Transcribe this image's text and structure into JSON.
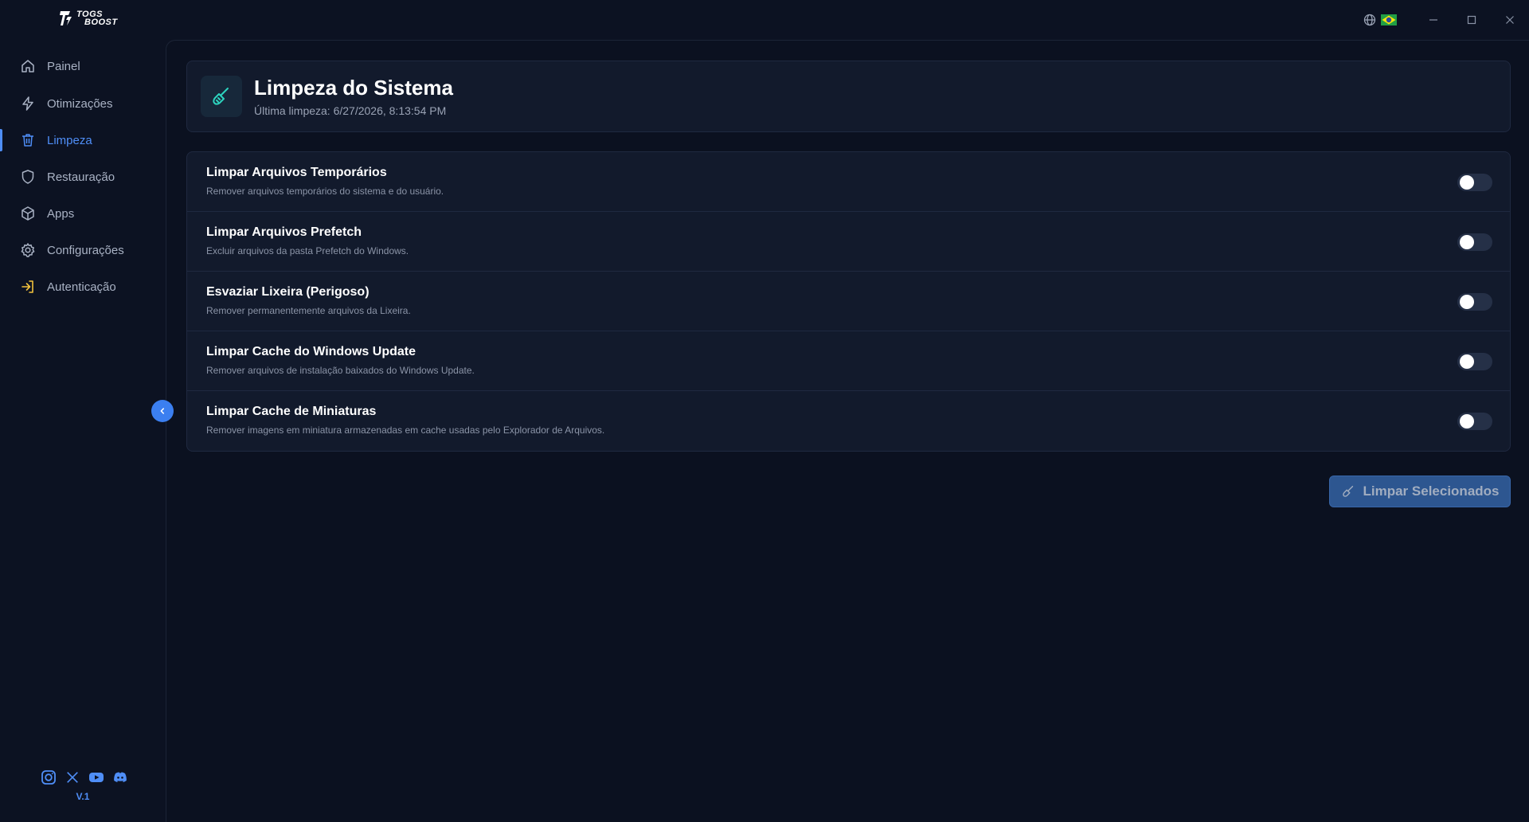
{
  "app": {
    "logo_line1": "TOGS",
    "logo_line2": "BOOST",
    "version": "V.1",
    "accent": "#4f8ef7"
  },
  "titlebar": {
    "language_icon": "globe-icon",
    "flag": "brazil-flag"
  },
  "sidebar": {
    "items": [
      {
        "label": "Painel",
        "icon": "home-icon"
      },
      {
        "label": "Otimizações",
        "icon": "lightning-icon"
      },
      {
        "label": "Limpeza",
        "icon": "trash-icon",
        "active": true
      },
      {
        "label": "Restauração",
        "icon": "shield-icon"
      },
      {
        "label": "Apps",
        "icon": "package-icon"
      },
      {
        "label": "Configurações",
        "icon": "gear-icon"
      },
      {
        "label": "Autenticação",
        "icon": "login-icon"
      }
    ],
    "socials": [
      "instagram-icon",
      "x-icon",
      "youtube-icon",
      "discord-icon"
    ]
  },
  "header": {
    "title": "Limpeza do Sistema",
    "subtitle": "Última limpeza: 6/27/2026, 8:13:54 PM"
  },
  "options": [
    {
      "title": "Limpar Arquivos Temporários",
      "desc": "Remover arquivos temporários do sistema e do usuário.",
      "enabled": false
    },
    {
      "title": "Limpar Arquivos Prefetch",
      "desc": "Excluir arquivos da pasta Prefetch do Windows.",
      "enabled": false
    },
    {
      "title": "Esvaziar Lixeira (Perigoso)",
      "desc": "Remover permanentemente arquivos da Lixeira.",
      "enabled": false
    },
    {
      "title": "Limpar Cache do Windows Update",
      "desc": "Remover arquivos de instalação baixados do Windows Update.",
      "enabled": false
    },
    {
      "title": "Limpar Cache de Miniaturas",
      "desc": "Remover imagens em miniatura armazenadas em cache usadas pelo Explorador de Arquivos.",
      "enabled": false
    }
  ],
  "actions": {
    "clean_label": "Limpar Selecionados"
  }
}
